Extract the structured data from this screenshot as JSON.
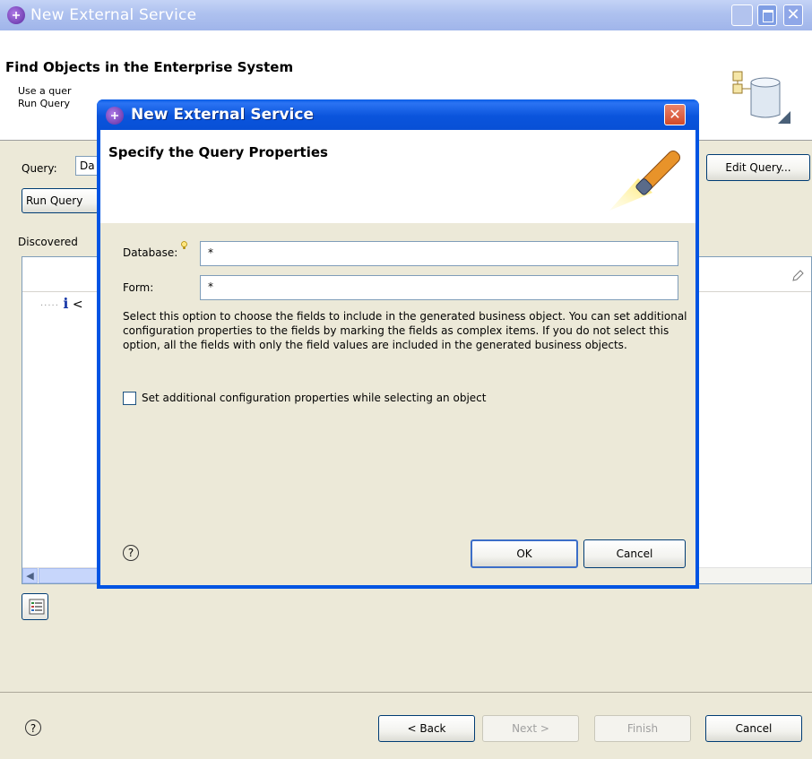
{
  "background_window": {
    "title": "New External Service",
    "page_heading": "Find Objects in the Enterprise System",
    "description_visible": "Use a quer\nRun Query",
    "query_label": "Query:",
    "query_value": "Da",
    "edit_query_label": "Edit Query...",
    "run_query_label": "Run Query",
    "discovered_label": "Discovered",
    "tree_item_prefix": "<",
    "help_glyph": "?",
    "back_label": "< Back",
    "next_label": "Next >",
    "finish_label": "Finish",
    "cancel_label": "Cancel"
  },
  "dialog": {
    "title": "New External Service",
    "heading": "Specify the Query Properties",
    "database_label": "Database:",
    "database_value": "*",
    "form_label": "Form:",
    "form_value": "*",
    "description": "Select this option to choose the fields to include in the generated business object. You can set additional configuration properties to the fields by marking the fields as complex items. If you do not select this option, all the fields with only the field values are included in the generated business objects.",
    "checkbox_label": "Set additional configuration properties while selecting an object",
    "checkbox_checked": false,
    "help_glyph": "?",
    "ok_label": "OK",
    "cancel_label": "Cancel"
  },
  "icons": [
    "app-icon",
    "minimize-icon",
    "maximize-icon",
    "close-icon",
    "database-icon",
    "pencil-icon",
    "info-icon",
    "scroll-left-icon",
    "list-icon",
    "help-icon",
    "wand-icon",
    "lightbulb-icon"
  ],
  "colors": {
    "dialog_titlebar": "#0054e3",
    "background_titlebar": "#a0b5ea",
    "window_face": "#ece9d8",
    "close_button": "#d24a2a"
  }
}
